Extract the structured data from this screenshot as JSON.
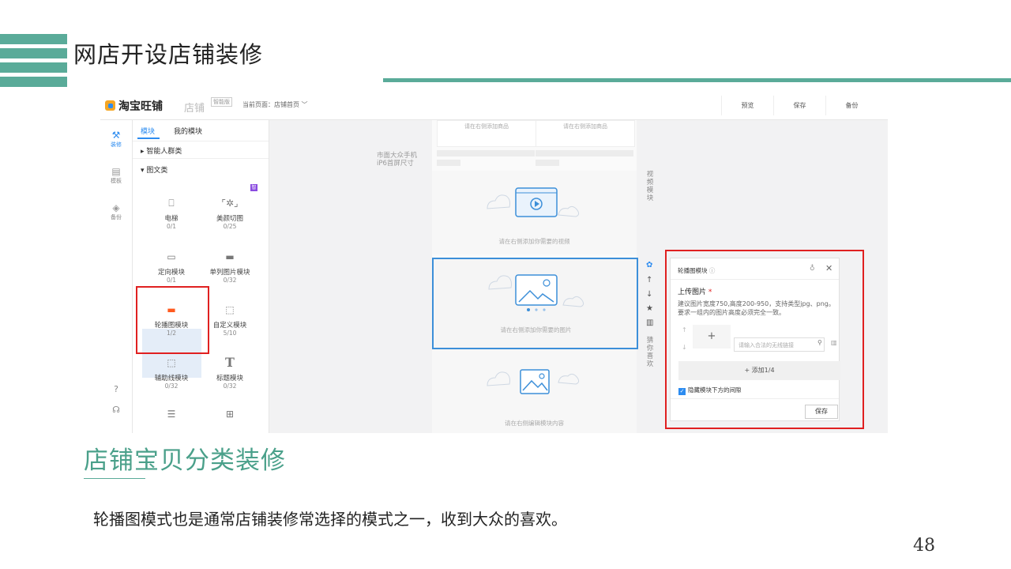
{
  "slide": {
    "title": "网店开设店铺装修",
    "section_title": "店铺宝贝分类装修",
    "body": "轮播图模式也是通常店铺装修常选择的模式之一，收到大众的喜欢。",
    "page_number": "48"
  },
  "app": {
    "logo": "淘宝旺铺",
    "store": "店铺",
    "store_tag": "智能版",
    "current_page": "当前页面：店铺首页 ﹀",
    "toolbar": {
      "preview": "预览",
      "save": "保存",
      "backup": "备份"
    }
  },
  "leftnav": [
    {
      "icon": "⚒",
      "label": "装修"
    },
    {
      "icon": "▤",
      "label": "模板"
    },
    {
      "icon": "◈",
      "label": "备份"
    }
  ],
  "modules": {
    "tabs": [
      "模块",
      "我的模块"
    ],
    "categories": [
      "▸ 智能人群类",
      "▾ 图文类"
    ],
    "badge": "智",
    "items": [
      {
        "icon": "⎕",
        "name": "电梯",
        "count": "0/1"
      },
      {
        "icon": "⌜✲⌟",
        "name": "美颜切图",
        "count": "0/25"
      },
      {
        "icon": "▭",
        "name": "定向模块",
        "count": "0/1"
      },
      {
        "icon": "▬",
        "name": "单列图片模块",
        "count": "0/32"
      },
      {
        "icon": "▬",
        "name": "轮播图模块",
        "count": "1/2"
      },
      {
        "icon": "⬚",
        "name": "自定义模块",
        "count": "5/10"
      },
      {
        "icon": "⬚",
        "name": "辅助线模块",
        "count": "0/32"
      },
      {
        "icon": "T",
        "name": "标题模块",
        "count": "0/32"
      },
      {
        "icon": "☰",
        "name": "",
        "count": ""
      },
      {
        "icon": "⊞",
        "name": "",
        "count": ""
      }
    ]
  },
  "canvas": {
    "hint": "市面大众手机\niP6首屏尺寸",
    "product_placeholder": "请在右侧添加商品",
    "video_hint": "请在右侧添加你需要的视频",
    "image_hint": "请在右侧添加你需要的图片",
    "edit_hint": "请在右侧编辑模块内容",
    "side_video": "视频模块",
    "side_guess": "猜你喜欢"
  },
  "props": {
    "title": "轮播图模块",
    "upload_label": "上传图片",
    "required_mark": "*",
    "desc": "建议图片宽度750,高度200-950，支持类型jpg、png。要求一组内的图片高度必须完全一致。",
    "link_placeholder": "请输入合法的无线链接",
    "add_label": "+ 添加1/4",
    "checkbox_label": "隐藏模块下方的间隙",
    "save": "保存"
  },
  "colors": {
    "accent": "#5aab99",
    "blue": "#2d8cf0",
    "red": "#e02020"
  }
}
